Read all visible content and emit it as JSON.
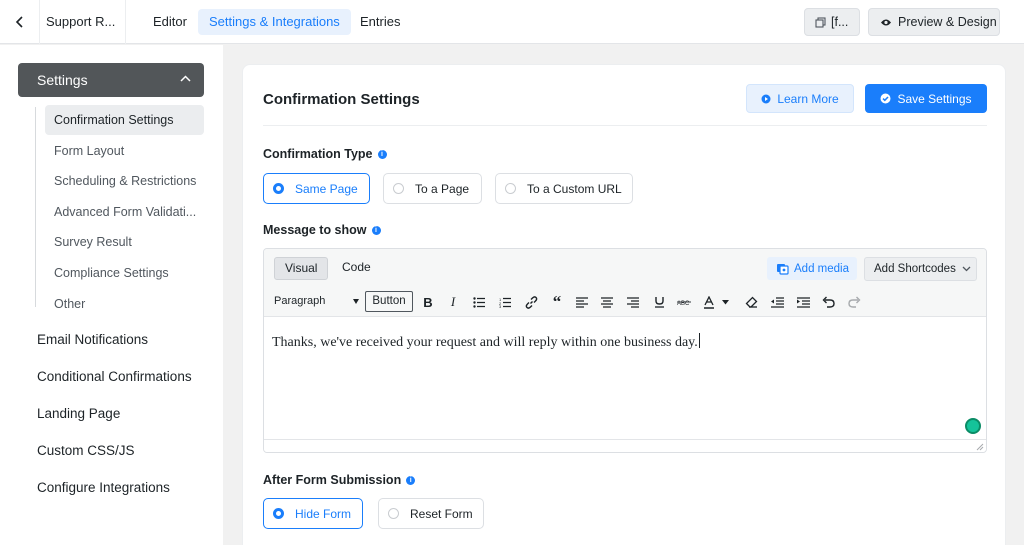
{
  "topbar": {
    "form_name": "Support R...",
    "tabs": [
      {
        "label": "Editor"
      },
      {
        "label": "Settings & Integrations"
      },
      {
        "label": "Entries"
      }
    ],
    "shortcode_label": "[f...",
    "preview_label": "Preview & Design"
  },
  "sidebar": {
    "header": "Settings",
    "sub_items": [
      {
        "label": "Confirmation Settings"
      },
      {
        "label": "Form Layout"
      },
      {
        "label": "Scheduling & Restrictions"
      },
      {
        "label": "Advanced Form Validati..."
      },
      {
        "label": "Survey Result"
      },
      {
        "label": "Compliance Settings"
      },
      {
        "label": "Other"
      }
    ],
    "main_items": [
      {
        "label": "Email Notifications"
      },
      {
        "label": "Conditional Confirmations"
      },
      {
        "label": "Landing Page"
      },
      {
        "label": "Custom CSS/JS"
      },
      {
        "label": "Configure Integrations"
      }
    ]
  },
  "main": {
    "title": "Confirmation Settings",
    "learn_more": "Learn More",
    "save_settings": "Save Settings",
    "confirmation_type": {
      "label": "Confirmation Type",
      "options": [
        "Same Page",
        "To a Page",
        "To a Custom URL"
      ],
      "selected": "Same Page"
    },
    "message": {
      "label": "Message to show",
      "tab_visual": "Visual",
      "tab_code": "Code",
      "add_media": "Add media",
      "add_shortcodes": "Add Shortcodes",
      "format_select": "Paragraph",
      "button_label": "Button",
      "content": "Thanks, we've received your request and will reply within one business day."
    },
    "after_submission": {
      "label": "After Form Submission",
      "options": [
        "Hide Form",
        "Reset Form"
      ],
      "selected": "Hide Form"
    }
  },
  "colors": {
    "accent": "#1a7efb",
    "sidebar_header": "#525659"
  }
}
